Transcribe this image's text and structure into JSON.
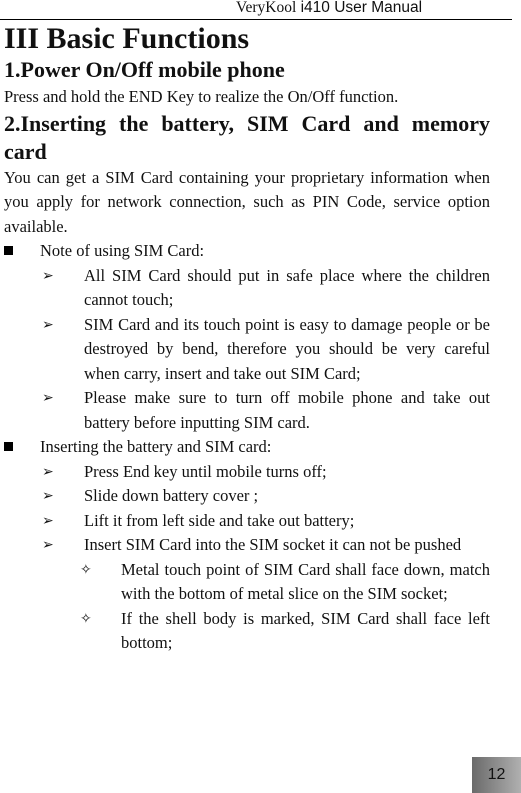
{
  "header": {
    "brand": "VeryKool",
    "model_title": " i410 User Manual"
  },
  "chapter_title": "III Basic Functions",
  "sections": [
    {
      "title": "1.Power On/Off mobile phone",
      "body": "Press and hold the END Key to realize the On/Off function."
    },
    {
      "title": "2.Inserting the battery, SIM Card and memory card",
      "body": "You can get a SIM Card containing your proprietary information when you apply for network connection, such as PIN Code, service option available."
    }
  ],
  "notes": {
    "heading": "Note of using SIM Card:",
    "items": [
      "All SIM Card should put in safe place where the children cannot touch;",
      "SIM Card and its touch point is easy to damage people or be destroyed by bend, therefore you should be very careful when carry, insert and take out SIM Card;",
      "Please make sure to turn off mobile phone and take out battery before inputting SIM card."
    ]
  },
  "inserting": {
    "heading": "Inserting the battery and SIM card:",
    "items": [
      "Press End key until mobile turns off;",
      "Slide down battery cover ;",
      "Lift it from left side and take out battery;",
      "Insert SIM Card into the SIM socket it can not be pushed"
    ],
    "sub_items": [
      "Metal touch point of SIM Card shall face down, match with the bottom of metal slice on the SIM socket;",
      "If the shell body is marked, SIM Card shall face left bottom;"
    ]
  },
  "bullets": {
    "square": "■",
    "arrow": "➢",
    "diamond": "✧"
  },
  "page_number": "12"
}
